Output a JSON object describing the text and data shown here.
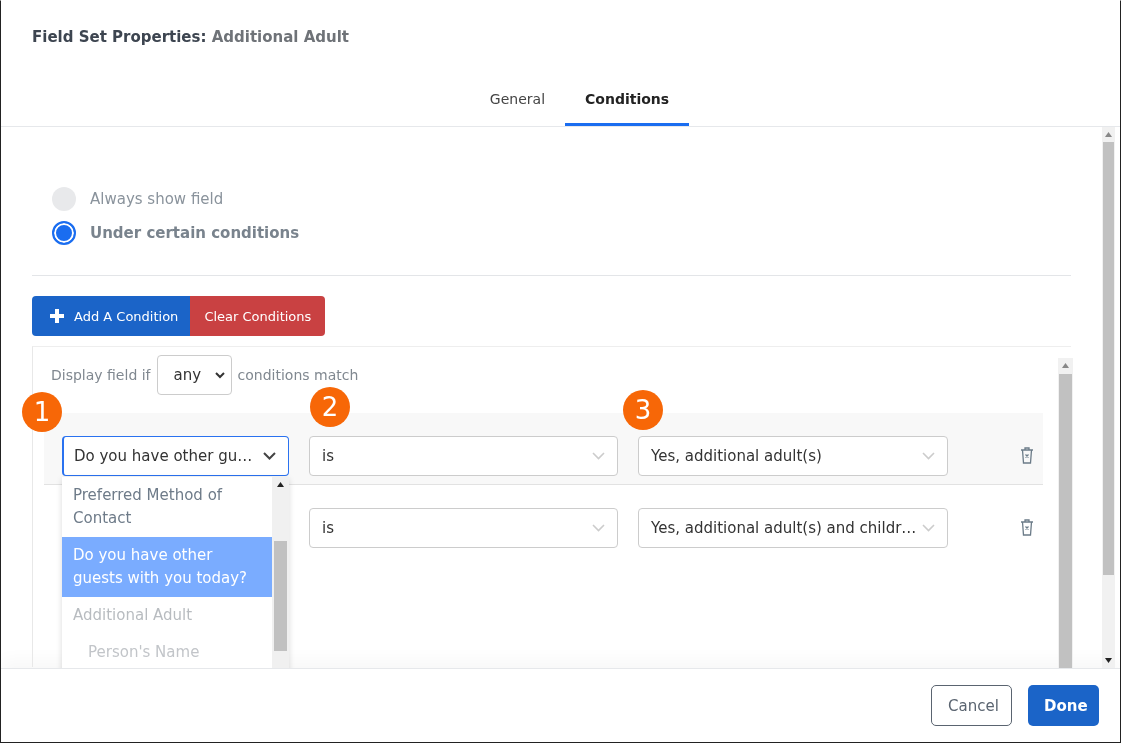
{
  "dialog": {
    "title_label": "Field Set Properties:",
    "title_value": "Additional Adult"
  },
  "tabs": [
    {
      "label": "General",
      "selected": false
    },
    {
      "label": "Conditions",
      "selected": true
    }
  ],
  "visibility_options": [
    {
      "label": "Always show field",
      "selected": false
    },
    {
      "label": "Under certain conditions",
      "selected": true
    }
  ],
  "toolbar": {
    "add_button": "Add A Condition",
    "clear_button": "Clear Conditions"
  },
  "match": {
    "prefix": "Display field if",
    "value": "any",
    "suffix": "conditions match"
  },
  "callouts": [
    "1",
    "2",
    "3"
  ],
  "conditions": [
    {
      "field": "Do you have other gu…",
      "operator": "is",
      "value": "Yes, additional adult(s)",
      "focused": true
    },
    {
      "operator": "is",
      "value": "Yes, additional adult(s) and childr…",
      "focused": false
    }
  ],
  "field_dropdown": {
    "options": [
      {
        "kind": "option",
        "label": "Preferred Method of Contact",
        "selected": false
      },
      {
        "kind": "option",
        "label": "Do you have other guests with you today?",
        "selected": true
      },
      {
        "kind": "group",
        "label": "Additional Adult",
        "children": [
          {
            "kind": "option",
            "label": "Person's Name",
            "selected": false,
            "disabled": true
          }
        ]
      }
    ]
  },
  "footer": {
    "buttons": [
      {
        "label": "Cancel",
        "kind": "secondary"
      },
      {
        "label": "Done",
        "kind": "primary"
      }
    ]
  }
}
